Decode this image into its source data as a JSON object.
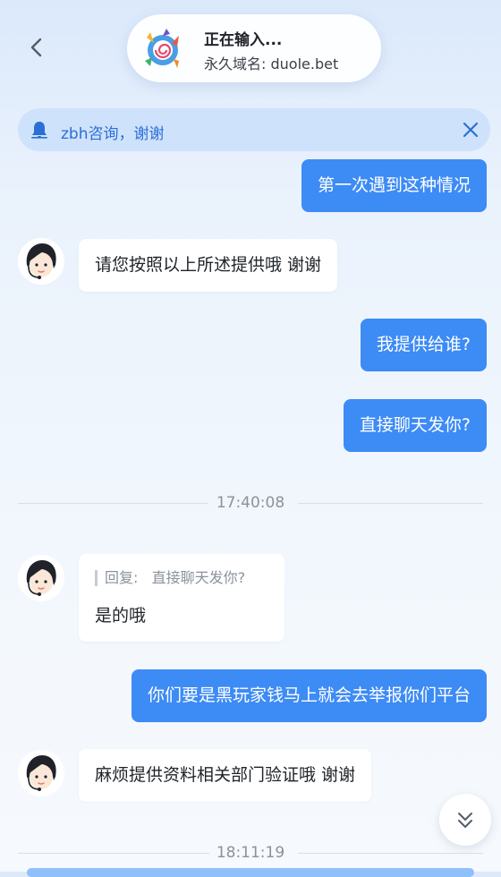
{
  "header": {
    "title": "正在输入...",
    "subtitle": "永久域名: duole.bet",
    "back_icon": "chevron-left-icon"
  },
  "notice": {
    "text": "zbh咨询，谢谢",
    "icon": "bell-icon",
    "close_icon": "close-icon",
    "accent": "#2a6fd6"
  },
  "messages": [
    {
      "from": "user",
      "text": "第一次遇到这种情况"
    },
    {
      "from": "agent",
      "text": "请您按照以上所述提供哦  谢谢"
    },
    {
      "from": "user",
      "text": "我提供给谁?"
    },
    {
      "from": "user",
      "text": "直接聊天发你?"
    },
    {
      "type": "time",
      "text": "17:40:08"
    },
    {
      "from": "agent",
      "reply_label": "回复:",
      "reply_text": "直接聊天发你?",
      "text": "是的哦"
    },
    {
      "from": "user",
      "text": "你们要是黑玩家钱马上就会去举报你们平台"
    },
    {
      "from": "agent",
      "text": "麻烦提供资料相关部门验证哦 谢谢"
    },
    {
      "type": "time",
      "text": "18:11:19"
    }
  ],
  "colors": {
    "user_bubble": "#3d8bf5",
    "agent_bubble": "#ffffff"
  },
  "scroll_icon": "double-chevron-down-icon"
}
